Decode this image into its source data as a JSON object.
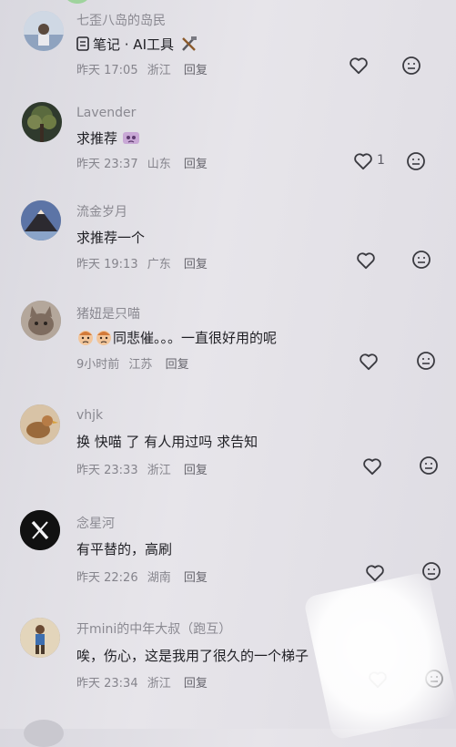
{
  "comments": [
    {
      "author": "七歪八岛的岛民",
      "text": "笔记 · AI工具",
      "date": "昨天 17:05",
      "location": "浙江",
      "reply": "回复",
      "likes": "",
      "avatar_icon": "person-icon",
      "avatar_color": "#8fa3bf"
    },
    {
      "author": "Lavender",
      "text": "求推荐",
      "date": "昨天 23:37",
      "location": "山东",
      "reply": "回复",
      "likes": "1",
      "avatar_icon": "tree-icon",
      "avatar_color": "#3f4a3d"
    },
    {
      "author": "流金岁月",
      "text": "求推荐一个",
      "date": "昨天 19:13",
      "location": "广东",
      "reply": "回复",
      "likes": "",
      "avatar_icon": "mountain-icon",
      "avatar_color": "#4b5f86"
    },
    {
      "author": "猪妞是只喵",
      "text": "同悲催。。。一直很好用的呢",
      "date": "9小时前",
      "location": "江苏",
      "reply": "回复",
      "likes": "",
      "avatar_icon": "cat-icon",
      "avatar_color": "#9c8a7c"
    },
    {
      "author": "vhjk",
      "text": "换 快喵 了 有人用过吗 求告知",
      "date": "昨天 23:33",
      "location": "浙江",
      "reply": "回复",
      "likes": "",
      "avatar_icon": "bird-icon",
      "avatar_color": "#b9a083"
    },
    {
      "author": "念星河",
      "text": "有平替的，高刷",
      "date": "昨天 22:26",
      "location": "湖南",
      "reply": "回复",
      "likes": "",
      "avatar_icon": "x-logo-icon",
      "avatar_color": "#111111"
    },
    {
      "author": "开mini的中年大叔（跑互）",
      "text": "唉，伤心，这是我用了很久的一个梯子",
      "date": "昨天 23:34",
      "location": "浙江",
      "reply": "回复",
      "likes": "",
      "avatar_icon": "runner-icon",
      "avatar_color": "#d9c7a5"
    }
  ]
}
